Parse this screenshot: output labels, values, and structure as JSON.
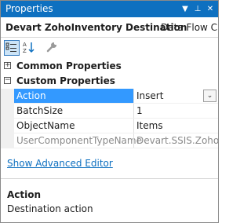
{
  "window": {
    "title": "Properties",
    "dropdown_glyph": "▼",
    "pin_glyph": "⊥",
    "close_glyph": "✕"
  },
  "object": {
    "name": "Devart ZohoInventory Destination",
    "type": "Data Flow C"
  },
  "toolbar": {
    "categorized_icon": "categorized-icon",
    "alphabetical_icon": "alphabetical-icon",
    "property_pages_icon": "wrench-icon"
  },
  "categories": [
    {
      "label": "Common Properties",
      "expanded": false,
      "glyph": "+"
    },
    {
      "label": "Custom Properties",
      "expanded": true,
      "glyph": "−"
    }
  ],
  "properties": [
    {
      "name": "Action",
      "value": "Insert",
      "selected": true,
      "disabled": false
    },
    {
      "name": "BatchSize",
      "value": "1",
      "selected": false,
      "disabled": false
    },
    {
      "name": "ObjectName",
      "value": "Items",
      "selected": false,
      "disabled": false
    },
    {
      "name": "UserComponentTypeName",
      "value": "Devart.SSIS.ZohoInv",
      "selected": false,
      "disabled": true
    }
  ],
  "dropdown_glyph": "⌄",
  "advanced_editor_link": "Show Advanced Editor",
  "description": {
    "title": "Action",
    "text": "Destination action"
  },
  "colors": {
    "titlebar": "#0e70c0",
    "selection": "#3399ff",
    "link": "#0e70c0"
  }
}
